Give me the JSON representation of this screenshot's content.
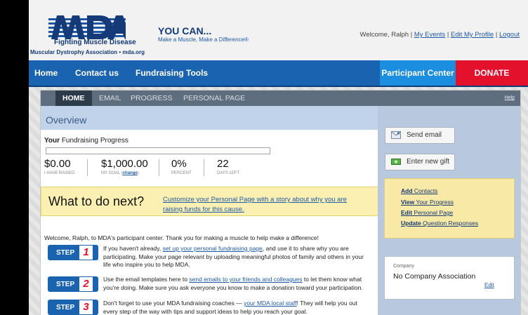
{
  "header": {
    "logo_tagline": "Fighting Muscle Disease",
    "logo_subline": "Muscular Dystrophy Association • mda.org",
    "headline": "YOU CAN...",
    "subheadline": "Make a Muscle, Make a Difference®",
    "welcome_text": "Welcome, Ralph | ",
    "link_events": "My Events",
    "divider": " | ",
    "link_profile": "Edit My Profile",
    "link_logout": "Logout"
  },
  "nav": {
    "home": "Home",
    "contact": "Contact us",
    "fundraising": "Fundraising Tools",
    "participant_center": "Participant Center",
    "donate": "DONATE"
  },
  "tabs": {
    "home": "HOME",
    "email": "EMAIL",
    "progress": "PROGRESS",
    "personal_page": "PERSONAL PAGE",
    "help": "Help"
  },
  "overview": {
    "title": "Overview",
    "progress_label_bold": "Your",
    "progress_label": " Fundraising Progress",
    "progress_fraction": 0,
    "raised_value": "$0.00",
    "raised_label": "I HAVE RAISED",
    "goal_value": "$1,000.00",
    "goal_label": "MY GOAL (",
    "goal_change": "change",
    "goal_label_end": ")",
    "percent_value": "0%",
    "percent_label": "PERCENT",
    "days_value": "22",
    "days_label": "DAYS LEFT"
  },
  "next": {
    "title": "What to do next?",
    "link": "Customize your Personal Page with a story about why you are raising funds for this cause."
  },
  "intro": "Welcome, Ralph, to MDA's participant center. Thank you for making a muscle to help make a difference!",
  "steps": [
    {
      "label": "STEP",
      "num": "1",
      "pre": "If you haven't already, ",
      "link": "set up your personal fundraising page",
      "post": ", and use it to share why you are participating. Make your page relevant by uploading meaningful photos of family and others in your life who inspire you to help MDA."
    },
    {
      "label": "STEP",
      "num": "2",
      "pre": "Use the email templates here to ",
      "link": "send emails to your friends and colleagues",
      "post": " to let them know what you're doing. Make sure you ask everyone you know to make a donation toward your participation."
    },
    {
      "label": "STEP",
      "num": "3",
      "pre": "Don't forget to use your MDA fundraising coaches — ",
      "link": "your MDA local staff",
      "post": "! They will help you out every step of the way with tips and support ideas to help you reach your goal."
    }
  ],
  "sidebar": {
    "send_email": "Send email",
    "enter_gift": "Enter new gift",
    "links": [
      {
        "bold": "Add",
        "rest": " Contacts"
      },
      {
        "bold": "View",
        "rest": " Your Progress"
      },
      {
        "bold": "Edit",
        "rest": " Personal Page"
      },
      {
        "bold": "Update",
        "rest": " Question Responses"
      }
    ],
    "company_label": "Company",
    "company_name": "No Company Association",
    "company_edit": "Edit"
  },
  "colors": {
    "nav_blue": "#1a63b0",
    "participant_center": "#1b8ee0",
    "donate_red": "#e4112c",
    "brand_navy": "#143a78"
  }
}
